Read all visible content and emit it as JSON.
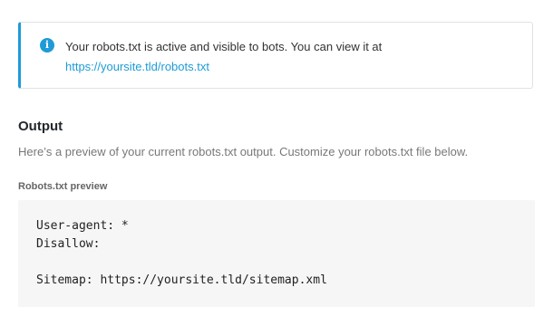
{
  "notice": {
    "icon": "info-icon",
    "message": "Your robots.txt is active and visible to bots. You can view it at",
    "link_text": "https://yoursite.tld/robots.txt",
    "accent_color": "#1e9bd7"
  },
  "output": {
    "title": "Output",
    "description": "Here’s a preview of your current robots.txt output. Customize your robots.txt file below.",
    "preview_label": "Robots.txt preview",
    "preview_lines": [
      "User-agent: *",
      "Disallow:",
      "",
      "Sitemap: https://yoursite.tld/sitemap.xml"
    ]
  }
}
